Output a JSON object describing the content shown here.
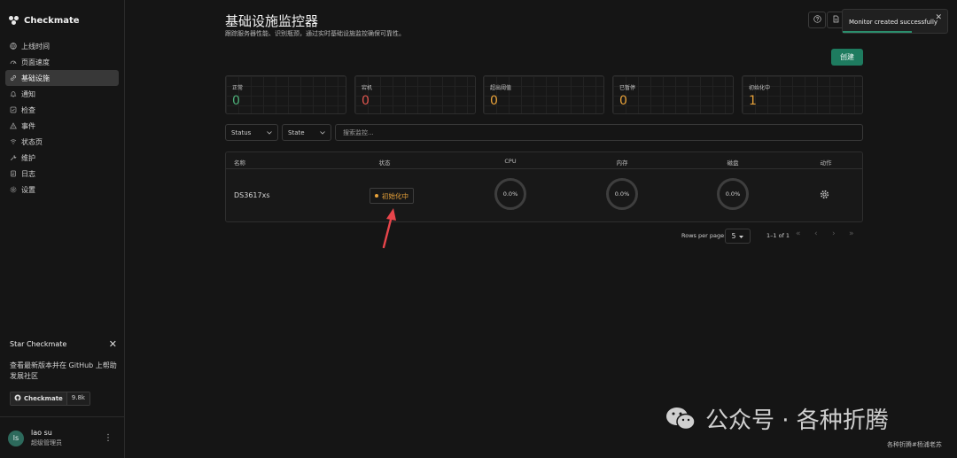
{
  "app": {
    "name": "Checkmate"
  },
  "sidebar": {
    "items": [
      {
        "label": "上线时间",
        "icon": "globe-icon"
      },
      {
        "label": "页面速度",
        "icon": "speedometer-icon"
      },
      {
        "label": "基础设施",
        "icon": "link-icon",
        "active": true
      },
      {
        "label": "通知",
        "icon": "bell-icon"
      },
      {
        "label": "检查",
        "icon": "checklist-icon"
      },
      {
        "label": "事件",
        "icon": "warning-icon"
      },
      {
        "label": "状态页",
        "icon": "signal-icon"
      },
      {
        "label": "维护",
        "icon": "wrench-icon"
      },
      {
        "label": "日志",
        "icon": "log-icon"
      },
      {
        "label": "设置",
        "icon": "settings-icon"
      }
    ]
  },
  "star_box": {
    "title": "Star Checkmate",
    "description": "查看最新版本并在 GitHub 上帮助发展社区",
    "badge_label": "Checkmate",
    "badge_count": "9.8k"
  },
  "user": {
    "initials": "ls",
    "name": "lao su",
    "role": "超级管理员"
  },
  "header": {
    "title": "基础设施监控器",
    "subtitle": "跟踪服务器性能、识别瓶颈，通过实时基础设施监控确保可靠性。"
  },
  "toast": {
    "message": "Monitor created successfully"
  },
  "create_button": {
    "label": "创建"
  },
  "stats": [
    {
      "label": "正常",
      "value": "0",
      "color": "#4caf78"
    },
    {
      "label": "宕机",
      "value": "0",
      "color": "#e0564f"
    },
    {
      "label": "超出阈值",
      "value": "0",
      "color": "#e8a23a"
    },
    {
      "label": "已暂停",
      "value": "0",
      "color": "#e8a23a"
    },
    {
      "label": "初始化中",
      "value": "1",
      "color": "#e8a23a"
    }
  ],
  "filters": {
    "status_label": "Status",
    "state_label": "State",
    "search_placeholder": "搜索监控..."
  },
  "table": {
    "columns": [
      "名称",
      "状态",
      "CPU",
      "内存",
      "磁盘",
      "动作"
    ],
    "rows": [
      {
        "name": "DS3617xs",
        "status": "初始化中",
        "cpu": "0.0%",
        "memory": "0.0%",
        "disk": "0.0%"
      }
    ]
  },
  "pagination": {
    "rows_per_page_label": "Rows per page:",
    "rows_per_page_value": "5",
    "range": "1–1 of 1"
  },
  "watermark": {
    "text": "公众号 · 各种折腾",
    "caption": "各种折腾#杨浦老苏"
  }
}
